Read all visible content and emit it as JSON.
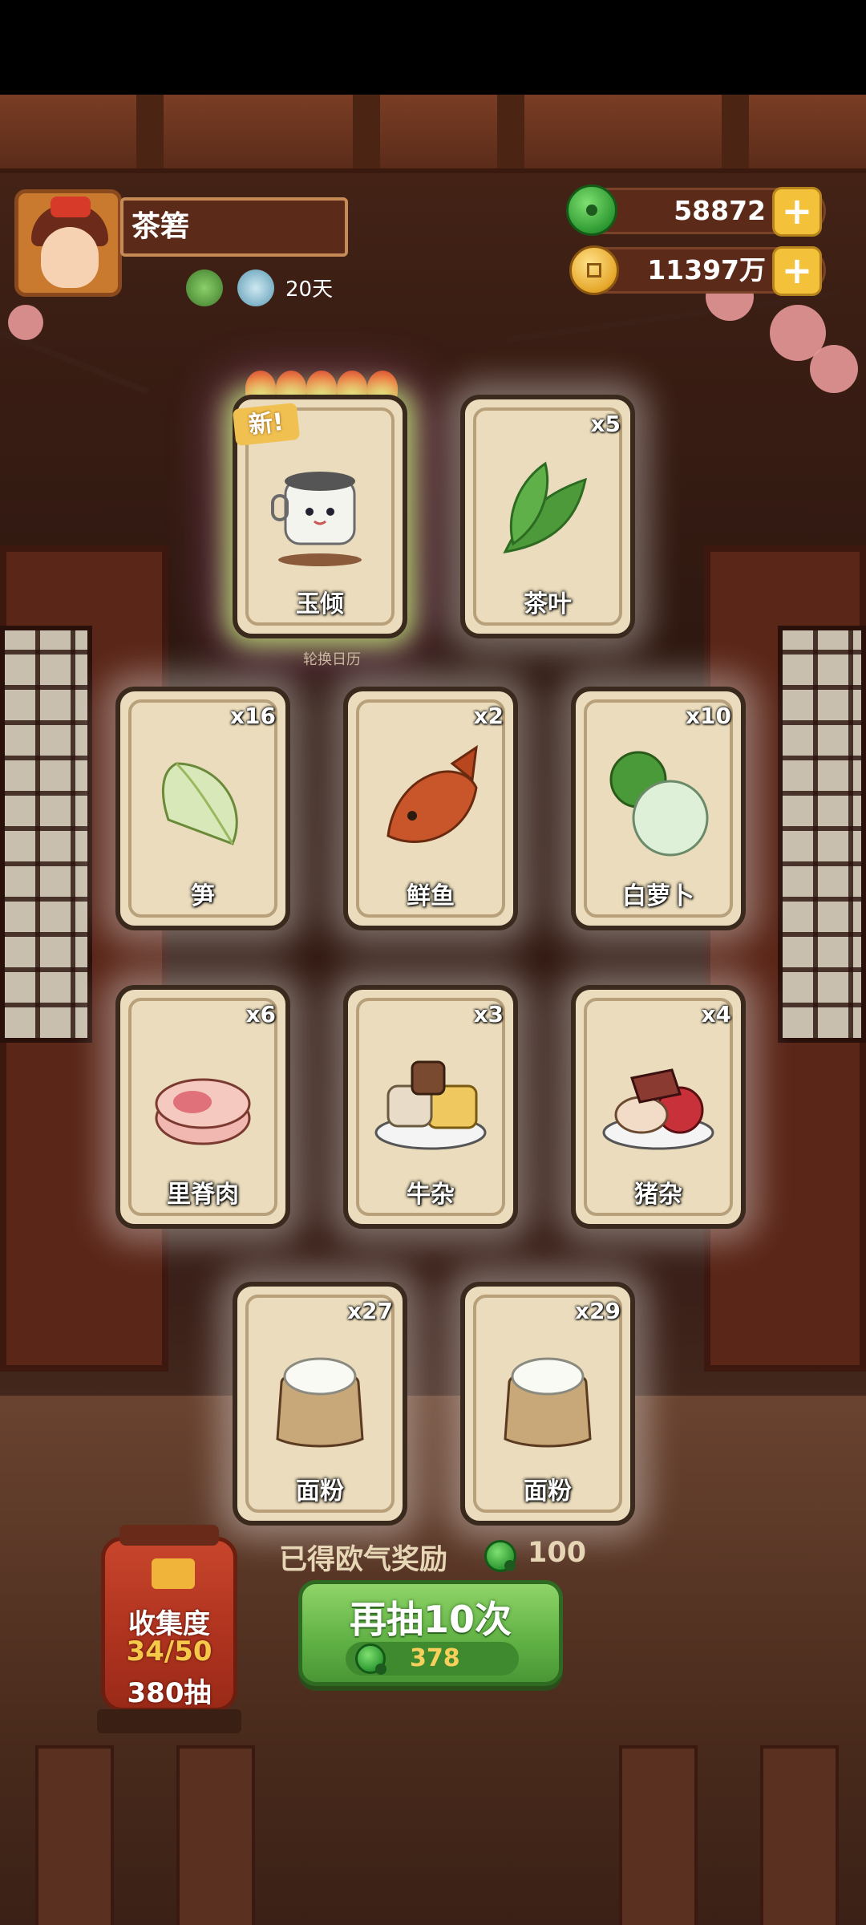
{
  "player": {
    "name": "茶箬",
    "days": "20天"
  },
  "currency": {
    "jade": "58872",
    "gold": "11397万"
  },
  "cards": [
    {
      "name": "玉倾",
      "count": "",
      "is_new": true,
      "new_label": "新!",
      "stars": 5
    },
    {
      "name": "茶叶",
      "count": "x5"
    },
    {
      "name": "笋",
      "count": "x16"
    },
    {
      "name": "鲜鱼",
      "count": "x2"
    },
    {
      "name": "白萝卜",
      "count": "x10"
    },
    {
      "name": "里脊肉",
      "count": "x6"
    },
    {
      "name": "牛杂",
      "count": "x3"
    },
    {
      "name": "猪杂",
      "count": "x4"
    },
    {
      "name": "面粉",
      "count": "x27"
    },
    {
      "name": "面粉",
      "count": "x29"
    }
  ],
  "background_caption": "轮换日历",
  "luck_reward": {
    "label": "已得欧气奖励",
    "value": "100"
  },
  "collection": {
    "title": "收集度",
    "progress": "34/50",
    "draws": "380抽"
  },
  "draw_button": {
    "label": "再抽10次",
    "cost": "378"
  },
  "colors": {
    "accent_green": "#5fb044",
    "gold": "#f3c23a",
    "wood": "#5b2a19"
  }
}
